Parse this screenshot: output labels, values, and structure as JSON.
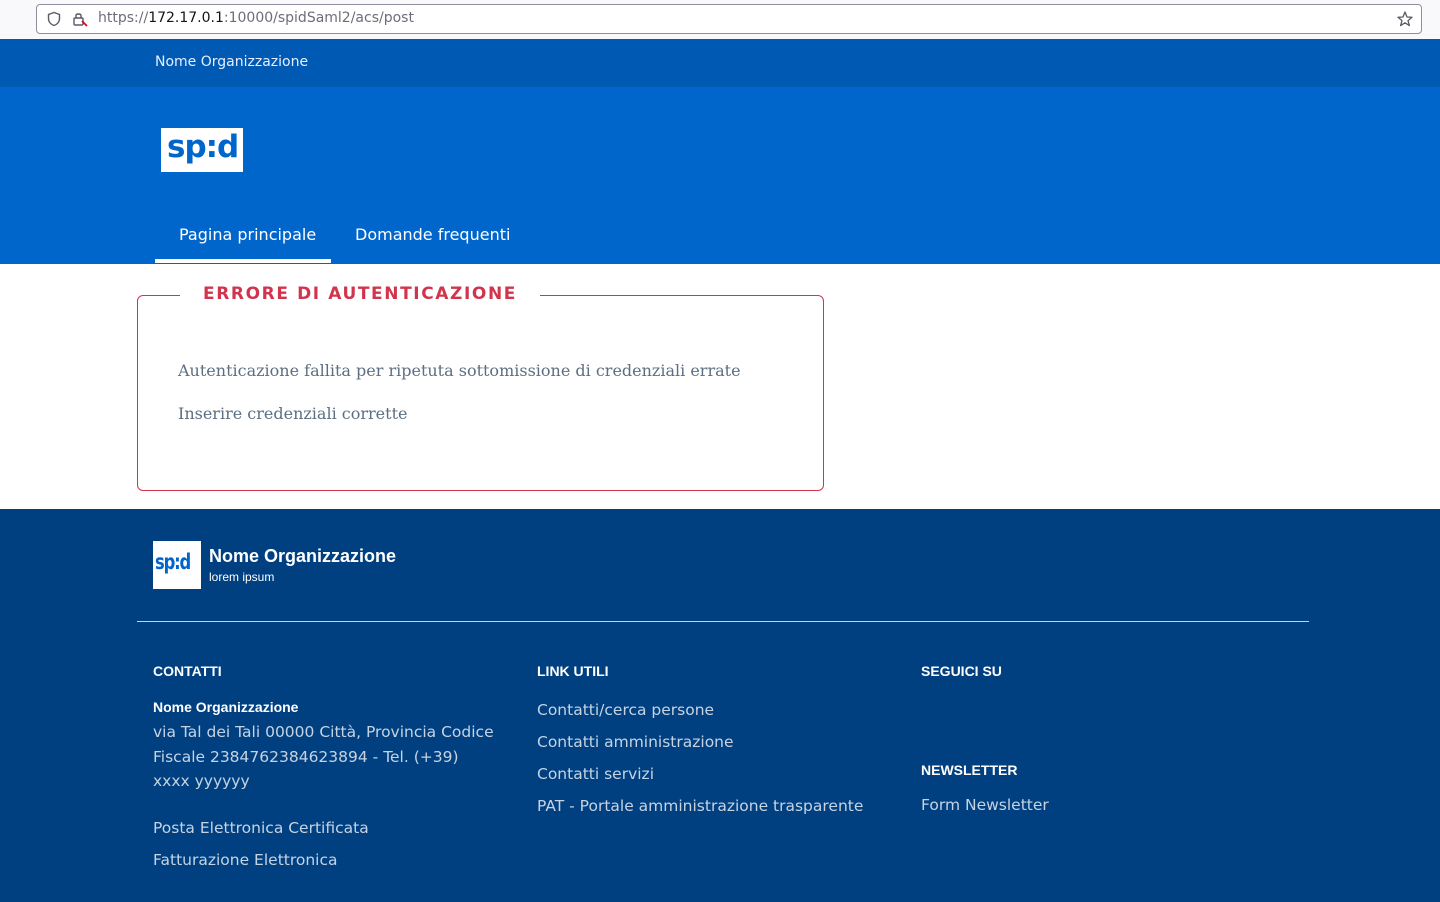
{
  "browser": {
    "url_scheme": "https://",
    "url_host": "172.17.0.1",
    "url_rest": ":10000/spidSaml2/acs/post"
  },
  "header": {
    "slim_org": "Nome Organizzazione",
    "logo_text": "sp:d",
    "nav": [
      {
        "label": "Pagina principale",
        "active": true
      },
      {
        "label": "Domande frequenti",
        "active": false
      }
    ]
  },
  "error": {
    "title": "ERRORE DI AUTENTICAZIONE",
    "message": "Autenticazione fallita per ripetuta sottomissione di credenziali errate",
    "hint": "Inserire credenziali corrette"
  },
  "footer": {
    "logo_text": "sp:d",
    "org_name": "Nome Organizzazione",
    "org_sub": "lorem ipsum",
    "contacts": {
      "heading": "CONTATTI",
      "name": "Nome Organizzazione",
      "address": "via Tal dei Tali 00000 Città, Provincia Codice Fiscale 2384762384623894 - Tel. (+39) xxxx yyyyyy",
      "links": [
        "Posta Elettronica Certificata",
        "Fatturazione Elettronica"
      ]
    },
    "useful_links": {
      "heading": "LINK UTILI",
      "links": [
        "Contatti/cerca persone",
        "Contatti amministrazione",
        "Contatti servizi",
        "PAT - Portale amministrazione trasparente"
      ]
    },
    "social": {
      "heading": "SEGUICI SU"
    },
    "newsletter": {
      "heading": "NEWSLETTER",
      "link": "Form Newsletter"
    }
  },
  "colors": {
    "slim_bg": "#0059b3",
    "header_bg": "#0066cc",
    "footer_bg": "#004080",
    "error": "#d1344c"
  }
}
